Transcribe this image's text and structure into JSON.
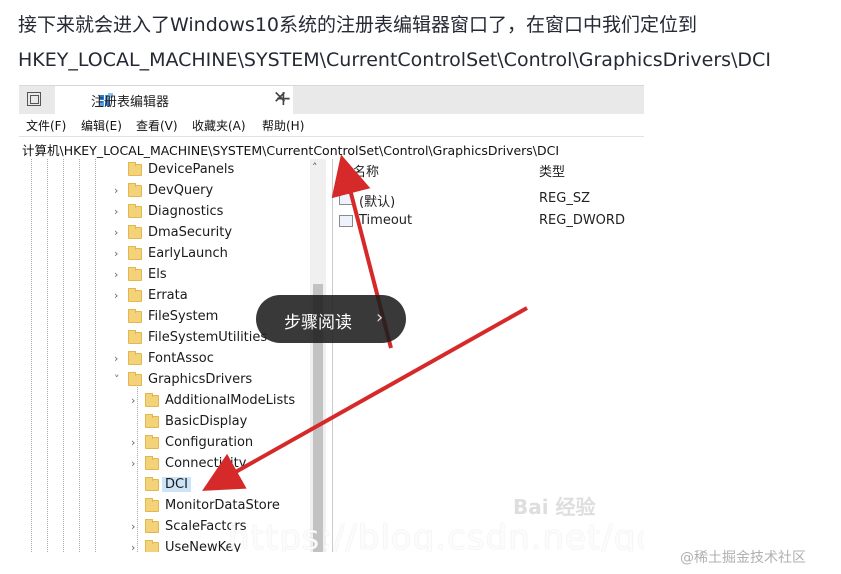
{
  "article": {
    "intro_text": "接下来就会进入了Windows10系统的注册表编辑器窗口了，在窗口中我们定位到HKEY_LOCAL_MACHINE\\SYSTEM\\CurrentControlSet\\Control\\GraphicsDrivers\\DCI"
  },
  "window": {
    "tab_title": "注册表编辑器",
    "tab_close": "✕",
    "new_tab": "+"
  },
  "menu": {
    "items": [
      "文件(F)",
      "编辑(E)",
      "查看(V)",
      "收藏夹(A)",
      "帮助(H)"
    ]
  },
  "address": {
    "path": "计算机\\HKEY_LOCAL_MACHINE\\SYSTEM\\CurrentControlSet\\Control\\GraphicsDrivers\\DCI"
  },
  "tree": {
    "items": [
      {
        "label": "DevicePanels"
      },
      {
        "label": "DevQuery"
      },
      {
        "label": "Diagnostics"
      },
      {
        "label": "DmaSecurity"
      },
      {
        "label": "EarlyLaunch"
      },
      {
        "label": "Els"
      },
      {
        "label": "Errata"
      },
      {
        "label": "FileSystem"
      },
      {
        "label": "FileSystemUtilities"
      },
      {
        "label": "FontAssoc"
      },
      {
        "label": "GraphicsDrivers"
      },
      {
        "label": "AdditionalModeLists"
      },
      {
        "label": "BasicDisplay"
      },
      {
        "label": "Configuration"
      },
      {
        "label": "Connectivity"
      },
      {
        "label": "DCI"
      },
      {
        "label": "MonitorDataStore"
      },
      {
        "label": "ScaleFactors"
      },
      {
        "label": "UseNewKey"
      }
    ]
  },
  "values": {
    "col_name": "名称",
    "col_type": "类型",
    "rows": [
      {
        "name": "(默认)",
        "type": "REG_SZ"
      },
      {
        "name": "Timeout",
        "type": "REG_DWORD"
      }
    ]
  },
  "overlay": {
    "step_read_label": "步骤阅读",
    "step_read_arrow": "›"
  },
  "watermarks": {
    "csdn": "https://blog.csdn.net/qq",
    "baidu": "Bai 经验",
    "juejin": "@稀土掘金技术社区"
  },
  "colors": {
    "arrow_red": "#d62a2a",
    "selection_blue": "#cce4f7",
    "folder_yellow": "#f4d27a"
  }
}
